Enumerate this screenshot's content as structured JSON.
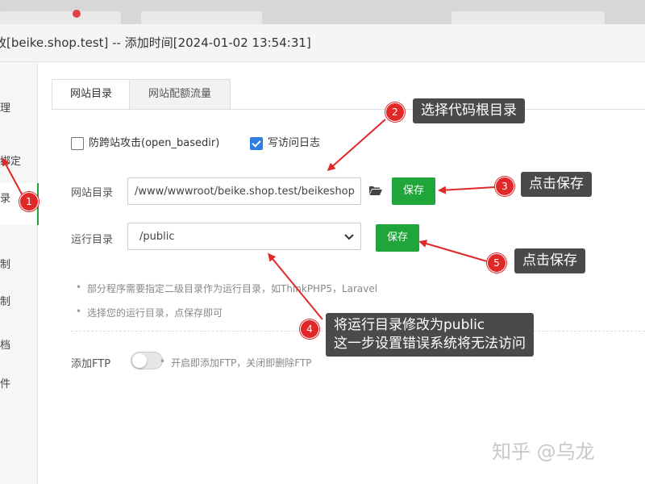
{
  "window": {
    "title": "[beike.shop.test] -- 添加时间[2024-01-02 13:54:31]",
    "title_prefix_glyph": "改"
  },
  "sidebar": {
    "items": [
      {
        "label": "理"
      },
      {
        "label": "绑定"
      },
      {
        "label": "录",
        "active": true
      },
      {
        "label": "制"
      },
      {
        "label": "制"
      },
      {
        "label": "档"
      },
      {
        "label": "件"
      }
    ]
  },
  "tabs": [
    {
      "label": "网站目录",
      "active": true
    },
    {
      "label": "网站配额流量",
      "active": false
    }
  ],
  "options": {
    "anti_cross": {
      "label": "防跨站攻击(open_basedir)",
      "checked": false
    },
    "access_log": {
      "label": "写访问日志",
      "checked": true
    }
  },
  "site_dir": {
    "label": "网站目录",
    "value": "/www/wwwroot/beike.shop.test/beikeshop",
    "save_label": "保存"
  },
  "run_dir": {
    "label": "运行目录",
    "value": "/public",
    "save_label": "保存"
  },
  "tips": [
    "部分程序需要指定二级目录作为运行目录，如ThinkPHP5，Laravel",
    "选择您的运行目录，点保存即可"
  ],
  "ftp": {
    "label": "添加FTP",
    "hint": "开启即添加FTP，关闭即删除FTP",
    "enabled": false
  },
  "annotations": [
    {
      "num": "1"
    },
    {
      "num": "2",
      "text": "选择代码根目录"
    },
    {
      "num": "3",
      "text": "点击保存"
    },
    {
      "num": "4",
      "text": "将运行目录修改为public",
      "text2": "这一步设置错误系统将无法访问"
    },
    {
      "num": "5",
      "text": "点击保存"
    }
  ],
  "watermark": "知乎 @乌龙",
  "colors": {
    "accent_green": "#20a53a",
    "checkbox_blue": "#2f7de1",
    "annotation_red": "#e02828",
    "callout_bg": "#4a4a4a"
  }
}
